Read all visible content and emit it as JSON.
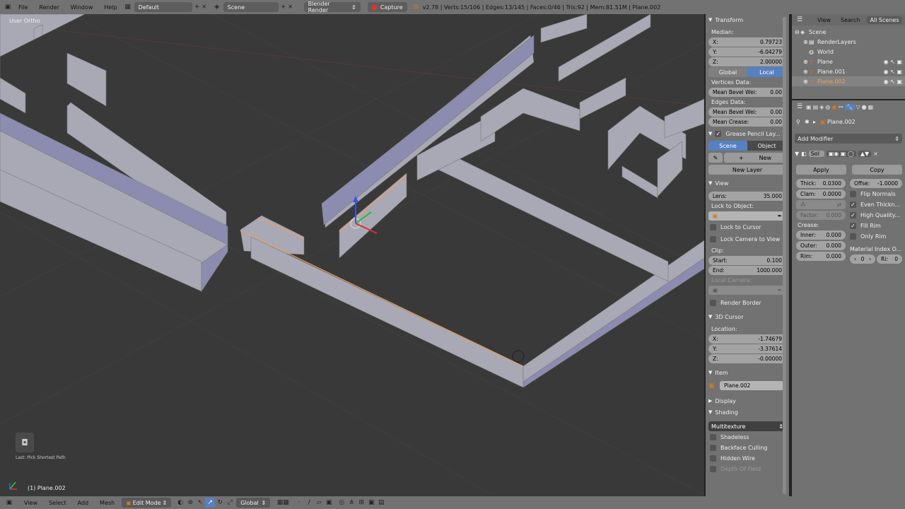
{
  "topbar": {
    "menus": [
      "File",
      "Render",
      "Window",
      "Help"
    ],
    "layout": "Default",
    "scene": "Scene",
    "engine": "Blender Render",
    "capture": "Capture",
    "stats": "v2.78 | Verts:15/106 | Edges:13/145 | Faces:0/46 | Tris:92 | Mem:81.51M | Plane.002"
  },
  "viewport": {
    "view_label": "User Ortho",
    "last_op": "Last: Pick Shortest Path",
    "object_label": "(1) Plane.002"
  },
  "npanel": {
    "transform": {
      "title": "Transform",
      "median": "Median:",
      "x_label": "X:",
      "x": "0.79723",
      "y_label": "Y:",
      "y": "-6.04279",
      "z_label": "Z:",
      "z": "2.00000",
      "global": "Global",
      "local": "Local",
      "vdata": "Vertices Data:",
      "bevel_label": "Mean Bevel Wei:",
      "bevel": "0.00",
      "edata": "Edges Data:",
      "ebevel_label": "Mean Bevel Wei:",
      "ebevel": "0.00",
      "crease_label": "Mean Crease:",
      "crease": "0.00"
    },
    "grease": {
      "title": "Grease Pencil Lay...",
      "scene": "Scene",
      "object": "Object",
      "new": "New",
      "new_layer": "New Layer"
    },
    "view": {
      "title": "View",
      "lens_label": "Lens:",
      "lens": "35.000",
      "lock_obj": "Lock to Object:",
      "lock_cursor": "Lock to Cursor",
      "lock_cam": "Lock Camera to View",
      "clip": "Clip:",
      "start_label": "Start:",
      "start": "0.100",
      "end_label": "End:",
      "end": "1000.000",
      "local_cam": "Local Camera:",
      "render_border": "Render Border"
    },
    "cursor": {
      "title": "3D Cursor",
      "location": "Location:",
      "x_label": "X:",
      "x": "-1.74679",
      "y_label": "Y:",
      "y": "-3.37614",
      "z_label": "Z:",
      "z": "-0.00000"
    },
    "item": {
      "title": "Item",
      "name": "Plane.002"
    },
    "display": {
      "title": "Display"
    },
    "shading": {
      "title": "Shading",
      "mode": "Multitexture",
      "shadeless": "Shadeless",
      "backface": "Backface Culling",
      "hidden_wire": "Hidden Wire",
      "dof": "Depth Of Field"
    }
  },
  "outliner": {
    "view": "View",
    "search": "Search",
    "all_scenes": "All Scenes",
    "items": [
      "Scene",
      "RenderLayers",
      "World",
      "Plane",
      "Plane.001",
      "Plane.002"
    ]
  },
  "props": {
    "object": "Plane.002",
    "add_modifier": "Add Modifier",
    "mod_name": "Sol",
    "apply": "Apply",
    "copy": "Copy",
    "thick_label": "Thick:",
    "thick": "0.0300",
    "offset_label": "Offse:",
    "offset": "-1.0000",
    "clamp_label": "Clam:",
    "clamp": "0.0000",
    "flip": "Flip Normals",
    "even": "Even Thickn...",
    "high": "High Quality...",
    "fill_rim": "Fill Rim",
    "only_rim": "Only Rim",
    "factor_label": "Factor:",
    "factor": "0.000",
    "crease": "Crease:",
    "inner_label": "Inner:",
    "inner": "0.000",
    "outer_label": "Outer:",
    "outer": "0.000",
    "rim_label": "Rim:",
    "rim": "0.000",
    "matidx": "Material Index O...",
    "mat0": "0",
    "mat_r_label": "Ri:",
    "mat_r": "0"
  },
  "botbar": {
    "menus": [
      "View",
      "Select",
      "Add",
      "Mesh"
    ],
    "mode": "Edit Mode",
    "orient": "Global"
  }
}
